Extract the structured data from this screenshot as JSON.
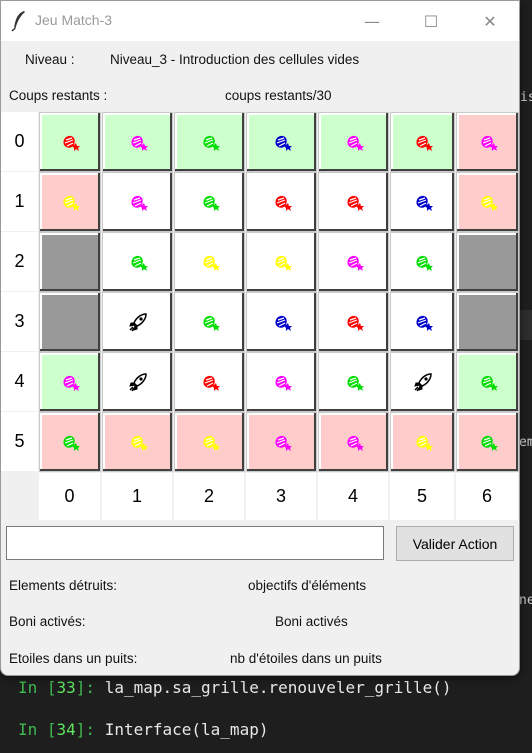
{
  "window": {
    "title": "Jeu Match-3",
    "minimize": "—",
    "maximize": "☐",
    "close": "✕"
  },
  "info": {
    "niveau_label": "Niveau :",
    "niveau_value": "Niveau_3 - Introduction des cellules vides",
    "coups_label": "Coups restants :",
    "coups_value": "coups restants/30"
  },
  "grid": {
    "row_labels": [
      "0",
      "1",
      "2",
      "3",
      "4",
      "5"
    ],
    "col_labels": [
      "0",
      "1",
      "2",
      "3",
      "4",
      "5",
      "6"
    ],
    "rows": [
      [
        [
          "green",
          "red"
        ],
        [
          "green",
          "magenta"
        ],
        [
          "green",
          "green"
        ],
        [
          "green",
          "blue"
        ],
        [
          "green",
          "magenta"
        ],
        [
          "green",
          "red"
        ],
        [
          "pink",
          "magenta"
        ]
      ],
      [
        [
          "pink",
          "yellow"
        ],
        [
          "white",
          "magenta"
        ],
        [
          "white",
          "green"
        ],
        [
          "white",
          "red"
        ],
        [
          "white",
          "red"
        ],
        [
          "white",
          "blue"
        ],
        [
          "pink",
          "yellow"
        ]
      ],
      [
        [
          "gray",
          ""
        ],
        [
          "white",
          "green"
        ],
        [
          "white",
          "yellow"
        ],
        [
          "white",
          "yellow"
        ],
        [
          "white",
          "magenta"
        ],
        [
          "white",
          "green"
        ],
        [
          "gray",
          ""
        ]
      ],
      [
        [
          "gray",
          ""
        ],
        [
          "white",
          "rocket"
        ],
        [
          "white",
          "green"
        ],
        [
          "white",
          "blue"
        ],
        [
          "white",
          "red"
        ],
        [
          "white",
          "blue"
        ],
        [
          "gray",
          ""
        ]
      ],
      [
        [
          "green",
          "magenta"
        ],
        [
          "white",
          "rocket"
        ],
        [
          "white",
          "red"
        ],
        [
          "white",
          "magenta"
        ],
        [
          "white",
          "green"
        ],
        [
          "white",
          "rocket"
        ],
        [
          "green",
          "green"
        ]
      ],
      [
        [
          "pink",
          "green"
        ],
        [
          "pink",
          "yellow"
        ],
        [
          "pink",
          "yellow"
        ],
        [
          "pink",
          "magenta"
        ],
        [
          "pink",
          "magenta"
        ],
        [
          "pink",
          "yellow"
        ],
        [
          "pink",
          "green"
        ]
      ]
    ],
    "candy_colors": {
      "red": "#ff0000",
      "magenta": "#ff00ff",
      "green": "#00dd00",
      "blue": "#0000cc",
      "yellow": "#ffff00"
    }
  },
  "action": {
    "input_value": "",
    "button_label": "Valider Action"
  },
  "stats": {
    "elements_label": "Elements détruits:",
    "elements_value": "objectifs d'éléments",
    "boni_label": "Boni activés:",
    "boni_value": "Boni activés",
    "etoiles_label": "Etoiles dans un puits:",
    "etoiles_value": "nb d'étoiles dans un puits"
  },
  "background": {
    "edge_texts": [
      "is",
      "em",
      "ne"
    ],
    "line1_prompt": "In [",
    "line1_num": "33",
    "line1_suffix": "]: ",
    "line1_code": "la_map.sa_grille.renouveler_grille()",
    "line2_prompt": "In [",
    "line2_num": "34",
    "line2_suffix": "]: ",
    "line2_code": "Interface(la_map)"
  }
}
